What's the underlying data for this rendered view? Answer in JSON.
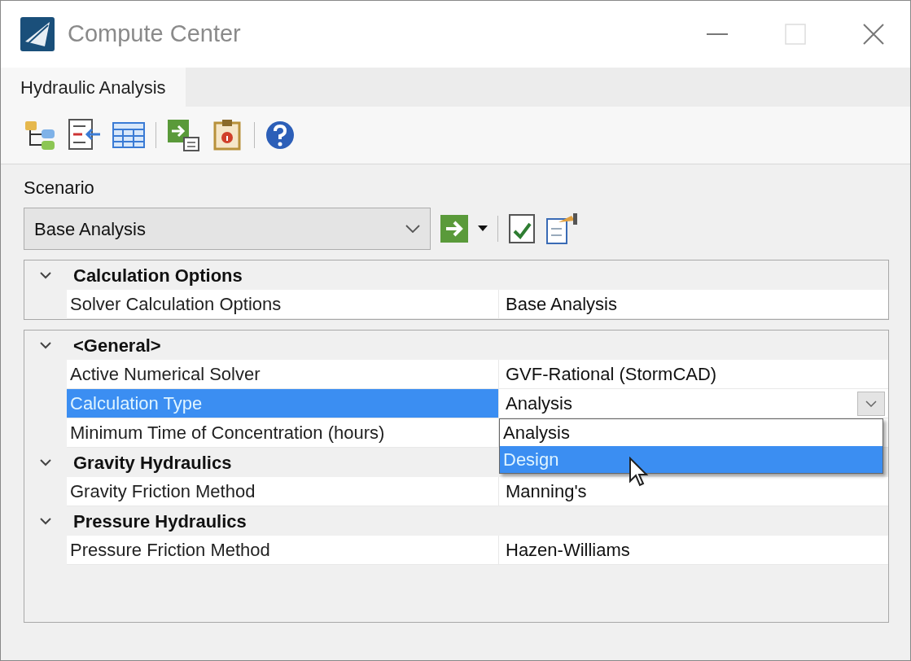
{
  "window": {
    "title": "Compute Center"
  },
  "tabs": [
    {
      "label": "Hydraulic Analysis",
      "selected": true
    }
  ],
  "scenario": {
    "label": "Scenario",
    "value": "Base Analysis"
  },
  "property_grids": [
    {
      "categories": [
        {
          "name": "Calculation Options",
          "expanded": true,
          "properties": [
            {
              "name": "Solver Calculation Options",
              "value": "Base Analysis",
              "selected": false
            }
          ]
        }
      ]
    },
    {
      "categories": [
        {
          "name": "<General>",
          "expanded": true,
          "properties": [
            {
              "name": "Active Numerical Solver",
              "value": "GVF-Rational (StormCAD)",
              "selected": false
            },
            {
              "name": "Calculation Type",
              "value": "Analysis",
              "selected": true,
              "dropdown": {
                "options": [
                  {
                    "label": "Analysis",
                    "selected": false
                  },
                  {
                    "label": "Design",
                    "selected": true
                  }
                ]
              }
            },
            {
              "name": "Minimum Time of Concentration (hours)",
              "selected": false
            }
          ]
        },
        {
          "name": "Gravity Hydraulics",
          "expanded": true,
          "properties": [
            {
              "name": "Gravity Friction Method",
              "value": "Manning's",
              "selected": false
            }
          ]
        },
        {
          "name": "Pressure Hydraulics",
          "expanded": true,
          "properties": [
            {
              "name": "Pressure Friction Method",
              "value": "Hazen-Williams",
              "selected": false
            }
          ]
        }
      ]
    }
  ]
}
